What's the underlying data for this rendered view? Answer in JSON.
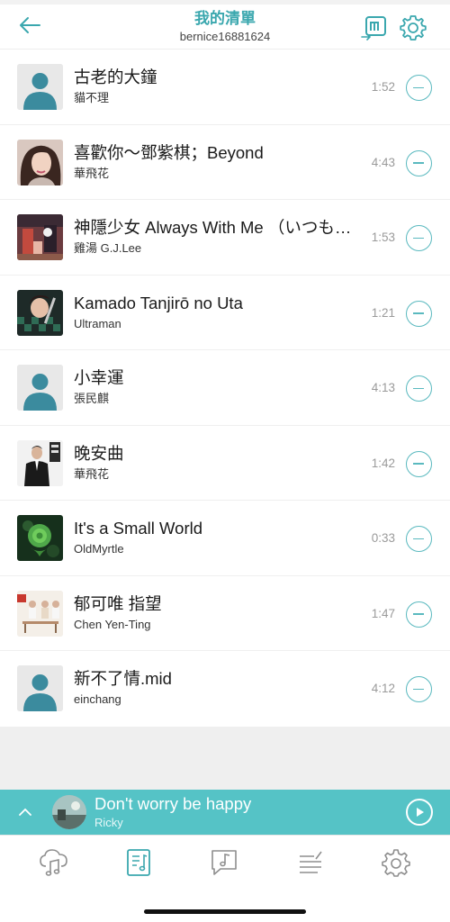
{
  "header": {
    "title": "我的清單",
    "username": "bernice16881624"
  },
  "songs": [
    {
      "title": "古老的大鐘",
      "artist": "貓不理",
      "duration": "1:52",
      "art": "default"
    },
    {
      "title": "喜歡你～鄧紫棋；Beyond",
      "artist": "華飛花",
      "duration": "4:43",
      "art": "portrait-woman"
    },
    {
      "title": "神隱少女 Always With Me （いつも何度でも）",
      "artist": "雞湯 G.J.Lee",
      "duration": "1:53",
      "art": "anime-spirited"
    },
    {
      "title": "Kamado Tanjirō no Uta",
      "artist": "Ultraman",
      "duration": "1:21",
      "art": "anime-checker"
    },
    {
      "title": "小幸運",
      "artist": "張民麒",
      "duration": "4:13",
      "art": "default"
    },
    {
      "title": "晚安曲",
      "artist": "華飛花",
      "duration": "1:42",
      "art": "suit-man"
    },
    {
      "title": "It's a Small World",
      "artist": "OldMyrtle",
      "duration": "0:33",
      "art": "green-rose"
    },
    {
      "title": "郁可唯 指望",
      "artist": "Chen Yen-Ting",
      "duration": "1:47",
      "art": "group-photo"
    },
    {
      "title": "新不了情.mid",
      "artist": "einchang",
      "duration": "4:12",
      "art": "default"
    }
  ],
  "now_playing": {
    "title": "Don't worry be happy",
    "artist": "Ricky"
  },
  "tabs": [
    {
      "name": "cloud-music-icon"
    },
    {
      "name": "playlist-icon",
      "active": true
    },
    {
      "name": "music-chat-icon"
    },
    {
      "name": "lyrics-icon"
    },
    {
      "name": "settings-gear-icon"
    }
  ],
  "colors": {
    "accent": "#3aa7ae",
    "now_playing_bg": "#55c3c6",
    "remove_ring": "#5ab9bf",
    "tab_inactive": "#8e8e8e"
  }
}
